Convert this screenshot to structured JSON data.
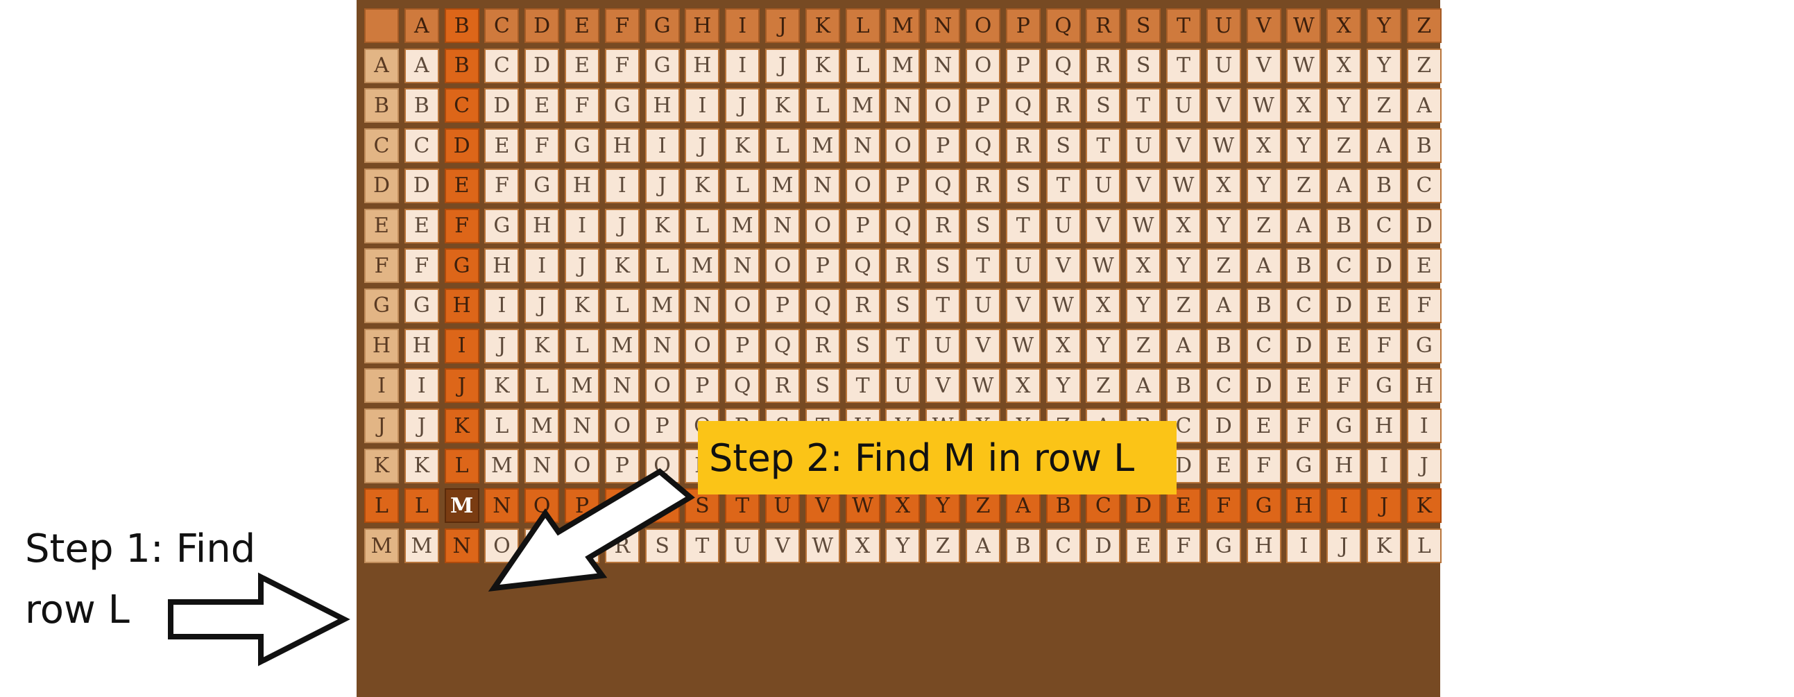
{
  "table": {
    "column_headers": [
      "A",
      "B",
      "C",
      "D",
      "E",
      "F",
      "G",
      "H",
      "I",
      "J",
      "K",
      "L",
      "M",
      "N",
      "O",
      "P",
      "Q",
      "R",
      "S",
      "T",
      "U",
      "V",
      "W",
      "X",
      "Y",
      "Z"
    ],
    "row_keys": [
      "A",
      "B",
      "C",
      "D",
      "E",
      "F",
      "G",
      "H",
      "I",
      "J",
      "K",
      "L",
      "M"
    ],
    "highlighted_column": "B",
    "highlighted_row": "L",
    "target_letter": "M"
  },
  "annotations": {
    "step1": "Step 1: Find\nrow L",
    "step2": "Step 2: Find M in row L"
  },
  "colors": {
    "board_frame": "#774a23",
    "header_cell": "#cf7a3d",
    "highlight": "#dd6619",
    "target_cell": "#7a3c12",
    "step2_box": "#fbc417"
  }
}
